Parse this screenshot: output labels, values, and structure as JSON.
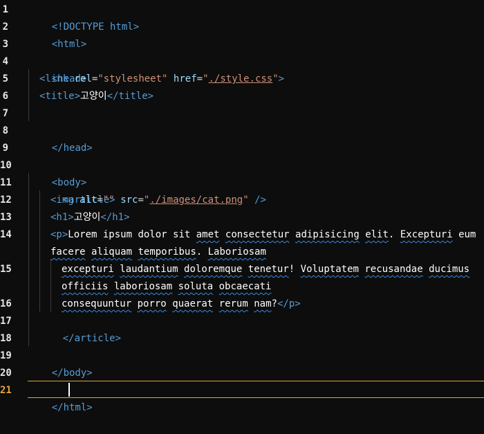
{
  "editor": {
    "active_line": 21,
    "line_numbers": [
      "1",
      "2",
      "3",
      "4",
      "5",
      "6",
      "7",
      "8",
      "9",
      "10",
      "11",
      "12",
      "13",
      "14",
      "15",
      "16",
      "17",
      "18",
      "19",
      "20",
      "21"
    ],
    "colors": {
      "background": "#0d0d0d",
      "tag": "#569cd6",
      "attribute": "#9cdcfe",
      "string": "#ce9178",
      "text": "#ffffff",
      "active_line_border": "#e5a33d",
      "spellcheck_squiggle": "#3a8be0"
    }
  },
  "code": {
    "l1": {
      "tag": "<!DOCTYPE html>"
    },
    "l2": {
      "tag": "<html>"
    },
    "l4": {
      "tag": "<head>"
    },
    "l5": {
      "open": "<link",
      "attr1": "rel",
      "eq1": "=",
      "val1": "\"stylesheet\"",
      "attr2": "href",
      "eq2": "=",
      "q_open": "\"",
      "val2": "./style.css",
      "q_close": "\"",
      "close": ">"
    },
    "l6": {
      "open": "<title>",
      "text": "고양이",
      "close": "</title>"
    },
    "l8": {
      "tag": "</head>"
    },
    "l10": {
      "tag": "<body>"
    },
    "l11": {
      "tag": "<article>"
    },
    "l12": {
      "open": "<img",
      "attr1": "alt",
      "eq1": "=",
      "val1": "\"\"",
      "attr2": "src",
      "eq2": "=",
      "q_open": "\"",
      "val2": "./images/cat.png",
      "q_close": "\"",
      "close": " />"
    },
    "l13": {
      "open": "<h1>",
      "text": "고양이",
      "close": "</h1>"
    },
    "l14": {
      "open": "<p>",
      "w1": "Lorem ipsum dolor sit ",
      "w2": "amet",
      "w3": " ",
      "w4": "consectetur",
      "w5": " ",
      "w6": "adipisicing",
      "w7": " ",
      "w8": "elit",
      "w9": ". ",
      "w10": "Excepturi",
      "w11": " eum"
    },
    "l14b": {
      "w1": "facere",
      "w2": " ",
      "w3": "aliquam",
      "w4": " ",
      "w5": "temporibus",
      "w6": ". ",
      "w7": "Laboriosam"
    },
    "l15": {
      "w1": "excepturi",
      "w2": " ",
      "w3": "laudantium",
      "w4": " ",
      "w5": "doloremque",
      "w6": " ",
      "w7": "tenetur",
      "w8": "! ",
      "w9": "Voluptatem",
      "w10": " ",
      "w11": "recusandae",
      "w12": " ",
      "w13": "ducimus"
    },
    "l15b": {
      "w1": "officiis",
      "w2": " ",
      "w3": "laboriosam",
      "w4": " ",
      "w5": "soluta",
      "w6": " ",
      "w7": "obcaecati"
    },
    "l16": {
      "w1": "consequuntur",
      "w2": " ",
      "w3": "porro",
      "w4": " ",
      "w5": "quaerat",
      "w6": " ",
      "w7": "rerum",
      "w8": " ",
      "w9": "nam",
      "w10": "?",
      "close": "</p>"
    },
    "l17": {
      "tag": "</article>"
    },
    "l19": {
      "tag": "</body>"
    },
    "l21": {
      "tag": "</html>"
    }
  }
}
